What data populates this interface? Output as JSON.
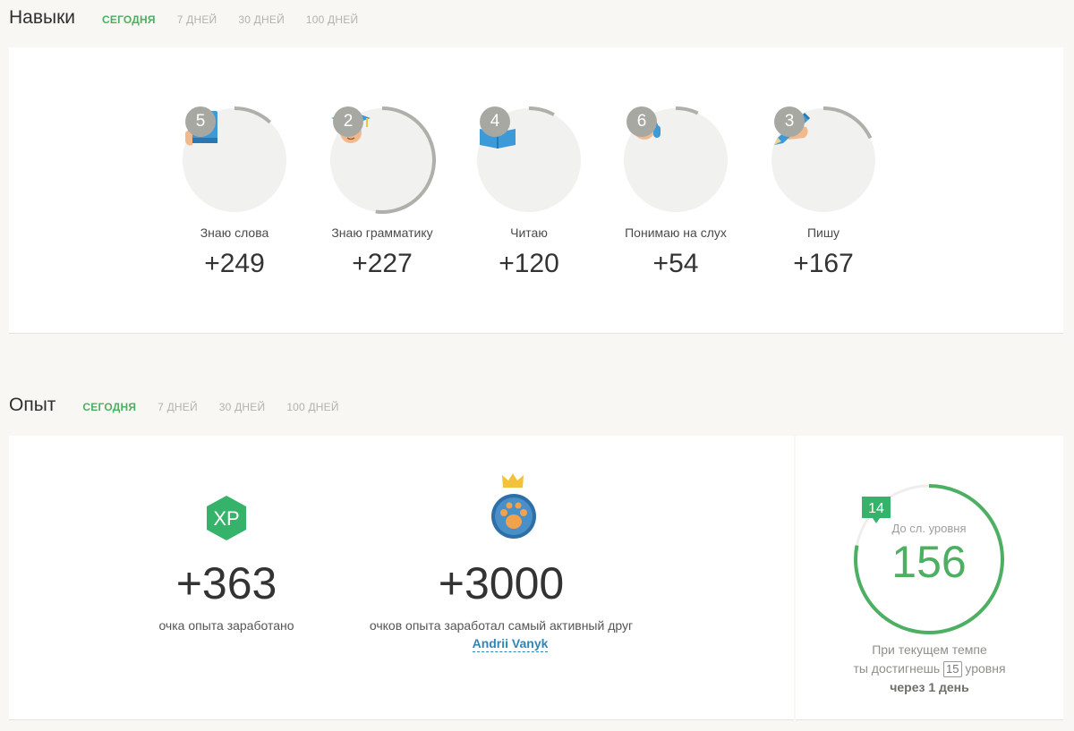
{
  "skills_section": {
    "title": "Навыки",
    "tabs": [
      {
        "label": "СЕГОДНЯ",
        "active": true
      },
      {
        "label": "7 ДНЕЙ",
        "active": false
      },
      {
        "label": "30 ДНЕЙ",
        "active": false
      },
      {
        "label": "100 ДНЕЙ",
        "active": false
      }
    ],
    "items": [
      {
        "level": "5",
        "label": "Знаю слова",
        "value": "+249",
        "icon": "vocabulary-book-icon",
        "progress": 0.12
      },
      {
        "level": "2",
        "label": "Знаю грамматику",
        "value": "+227",
        "icon": "graduate-cap-icon",
        "progress": 0.52
      },
      {
        "level": "4",
        "label": "Читаю",
        "value": "+120",
        "icon": "reading-icon",
        "progress": 0.08
      },
      {
        "level": "6",
        "label": "Понимаю на слух",
        "value": "+54",
        "icon": "headphones-icon",
        "progress": 0.07
      },
      {
        "level": "3",
        "label": "Пишу",
        "value": "+167",
        "icon": "writing-pencil-icon",
        "progress": 0.18
      }
    ]
  },
  "experience_section": {
    "title": "Опыт",
    "tabs": [
      {
        "label": "СЕГОДНЯ",
        "active": true
      },
      {
        "label": "7 ДНЕЙ",
        "active": false
      },
      {
        "label": "30 ДНЕЙ",
        "active": false
      },
      {
        "label": "100 ДНЕЙ",
        "active": false
      }
    ],
    "xp": {
      "badge": "XP",
      "value": "+363",
      "caption": "очка опыта заработано"
    },
    "friend": {
      "value": "+3000",
      "caption": "очков опыта заработал самый активный друг",
      "name": "Andrii Vanyk"
    },
    "level": {
      "current": "14",
      "caption": "До сл. уровня",
      "remaining": "156",
      "progress": 0.78,
      "pace_line1": "При текущем темпе",
      "pace_line2_a": "ты достигнешь",
      "next_level": "15",
      "pace_line2_b": "уровня",
      "pace_line3": "через 1 день"
    }
  },
  "colors": {
    "accent_green": "#4caf62",
    "ring_gray": "#b0b0ab",
    "link_blue": "#2d86b8"
  }
}
